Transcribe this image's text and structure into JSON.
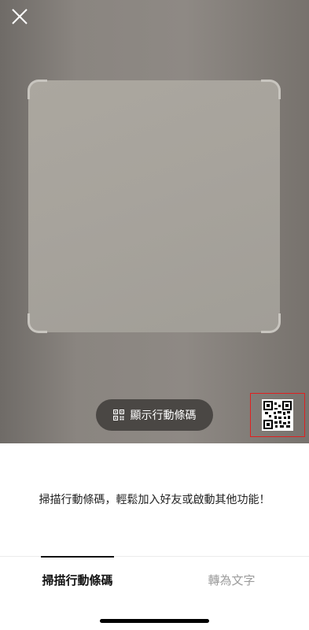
{
  "camera": {
    "close_icon": "close-icon",
    "show_code_label": "顯示行動條碼",
    "show_code_icon": "qr-code-icon",
    "gallery_icon": "qr-code-thumbnail"
  },
  "hint_text": "掃描行動條碼，輕鬆加入好友或啟動其他功能！",
  "tabs": [
    {
      "label": "掃描行動條碼",
      "active": true
    },
    {
      "label": "轉為文字",
      "active": false
    }
  ],
  "colors": {
    "highlight_border": "#e02020",
    "active_tab": "#111111",
    "inactive_tab": "#9c9c9c"
  }
}
